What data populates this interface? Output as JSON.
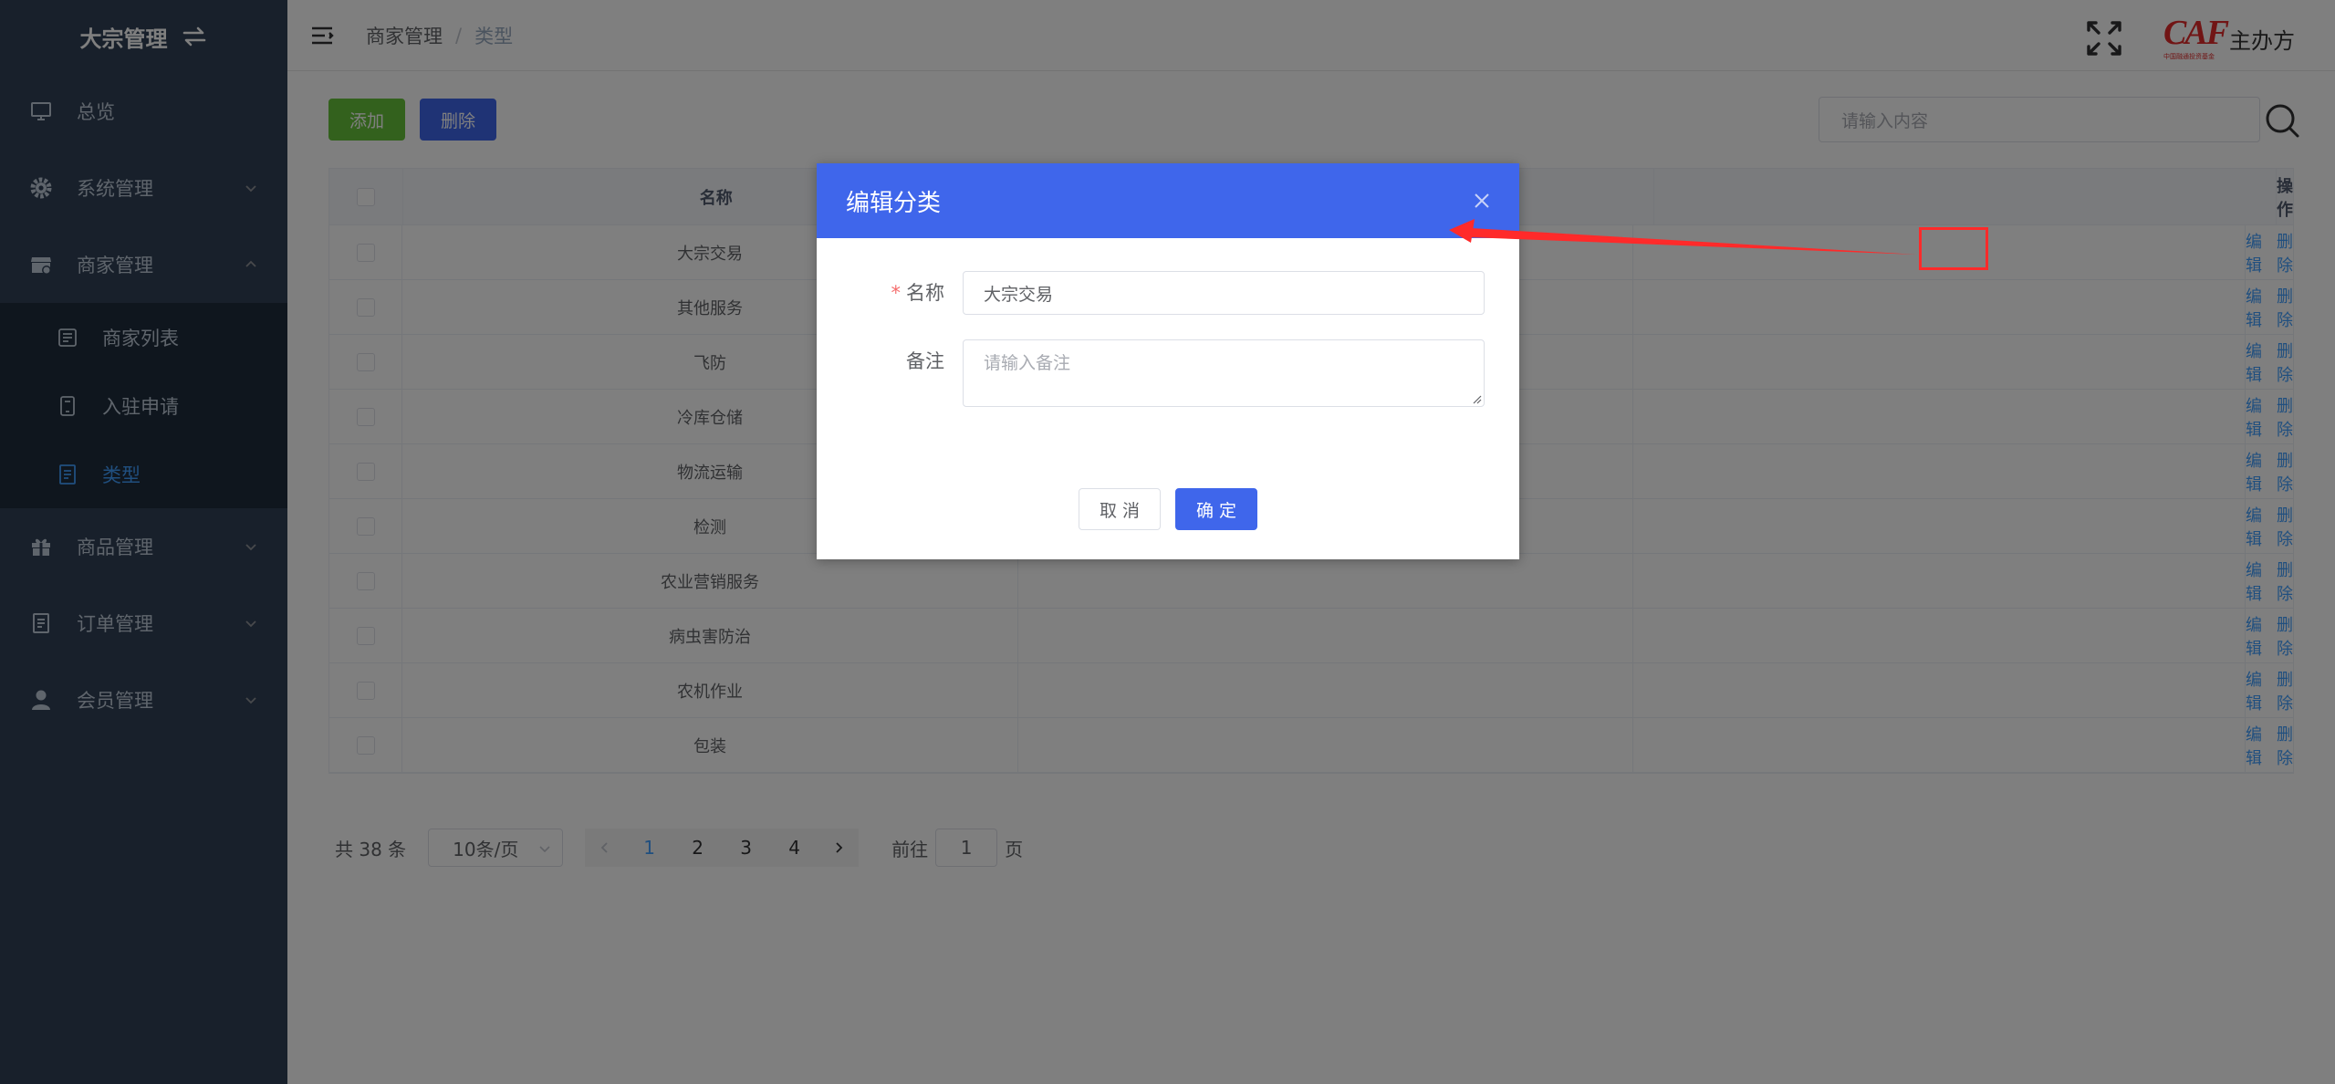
{
  "sidebar": {
    "title": "大宗管理",
    "items": [
      {
        "label": "总览",
        "icon": "monitor-icon"
      },
      {
        "label": "系统管理",
        "icon": "gear-icon"
      },
      {
        "label": "商家管理",
        "icon": "store-icon"
      },
      {
        "label": "商品管理",
        "icon": "gift-icon"
      },
      {
        "label": "订单管理",
        "icon": "document-icon"
      },
      {
        "label": "会员管理",
        "icon": "user-icon"
      }
    ],
    "sub_items": [
      {
        "label": "商家列表",
        "icon": "list-icon"
      },
      {
        "label": "入驻申请",
        "icon": "tablet-icon"
      },
      {
        "label": "类型",
        "icon": "file-icon"
      }
    ]
  },
  "header": {
    "breadcrumb": [
      "商家管理",
      "类型"
    ],
    "separator": "/",
    "brand_logo": "CAF",
    "brand_logo_sub": "中国融通投资基金",
    "brand_name": "主办方"
  },
  "toolbar": {
    "add_label": "添加",
    "delete_label": "删除",
    "search_placeholder": "请输入内容"
  },
  "table": {
    "col_name": "名称",
    "col_op": "操作",
    "edit_label": "编辑",
    "delete_label": "删除",
    "rows": [
      "大宗交易",
      "其他服务",
      "飞防",
      "冷库仓储",
      "物流运输",
      "检测",
      "农业营销服务",
      "病虫害防治",
      "农机作业",
      "包装"
    ]
  },
  "pagination": {
    "total": "共 38 条",
    "page_size": "10条/页",
    "pages": [
      "1",
      "2",
      "3",
      "4"
    ],
    "current_page": "1",
    "goto_label": "前往",
    "goto_value": "1",
    "page_suffix": "页"
  },
  "dialog": {
    "title": "编辑分类",
    "required_mark": "*",
    "name_label": "名称",
    "name_value": "大宗交易",
    "remark_label": "备注",
    "remark_placeholder": "请输入备注",
    "cancel_label": "取 消",
    "confirm_label": "确 定"
  },
  "colors": {
    "sidebar_bg": "#304156",
    "primary": "#3f66eb",
    "success": "#67c23a",
    "link": "#409eff",
    "annotation": "#ff2a2a"
  }
}
